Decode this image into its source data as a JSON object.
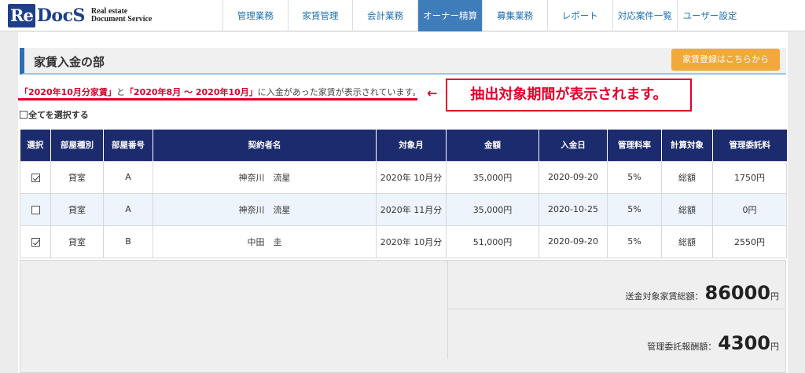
{
  "logo": {
    "re": "Re",
    "docs": "DocS",
    "sub1": "Real estate",
    "sub2": "Document Service"
  },
  "nav": [
    {
      "label": "管理業務",
      "active": false
    },
    {
      "label": "家賃管理",
      "active": false
    },
    {
      "label": "会計業務",
      "active": false
    },
    {
      "label": "オーナー精算",
      "active": true
    },
    {
      "label": "募集業務",
      "active": false
    },
    {
      "label": "レポート",
      "active": false
    },
    {
      "label": "対応案件一覧",
      "active": false
    },
    {
      "label": "ユーザー設定",
      "active": false
    }
  ],
  "section": {
    "title": "家賃入金の部",
    "register_button": "家賃登録はこちらから"
  },
  "notice": {
    "part1": "「2020年10月分家賃」",
    "part2": "と",
    "part3": "「2020年8月 ～ 2020年10月」",
    "part4": "に入金があった家賃が表示されています。"
  },
  "annotation": {
    "arrow": "←",
    "callout": "抽出対象期間が表示されます。"
  },
  "select_all": "全てを選択する",
  "table": {
    "headers": [
      "選択",
      "部屋種別",
      "部屋番号",
      "契約者名",
      "対象月",
      "金額",
      "入金日",
      "管理料率",
      "計算対象",
      "管理委託料"
    ],
    "rows": [
      {
        "checked": true,
        "type": "貸室",
        "room": "A",
        "name": "神奈川　流星",
        "month": "2020年 10月分",
        "amount": "35,000円",
        "date": "2020-09-20",
        "rate": "5%",
        "basis": "総額",
        "fee": "1750円"
      },
      {
        "checked": false,
        "type": "貸室",
        "room": "A",
        "name": "神奈川　流星",
        "month": "2020年 11月分",
        "amount": "35,000円",
        "date": "2020-10-25",
        "rate": "5%",
        "basis": "総額",
        "fee": "0円"
      },
      {
        "checked": true,
        "type": "貸室",
        "room": "B",
        "name": "中田　圭",
        "month": "2020年 10月分",
        "amount": "51,000円",
        "date": "2020-09-20",
        "rate": "5%",
        "basis": "総額",
        "fee": "2550円"
      }
    ]
  },
  "summary": {
    "rent_label": "送金対象家賃総額：",
    "rent_value": "86000",
    "rent_unit": "円",
    "fee_label": "管理委託報酬額：",
    "fee_value": "4300",
    "fee_unit": "円"
  },
  "colors": {
    "nav_active": "#3f7dba",
    "header_th": "#1c2b6e",
    "accent_red": "#e3002b",
    "button_orange": "#f0a93a"
  }
}
